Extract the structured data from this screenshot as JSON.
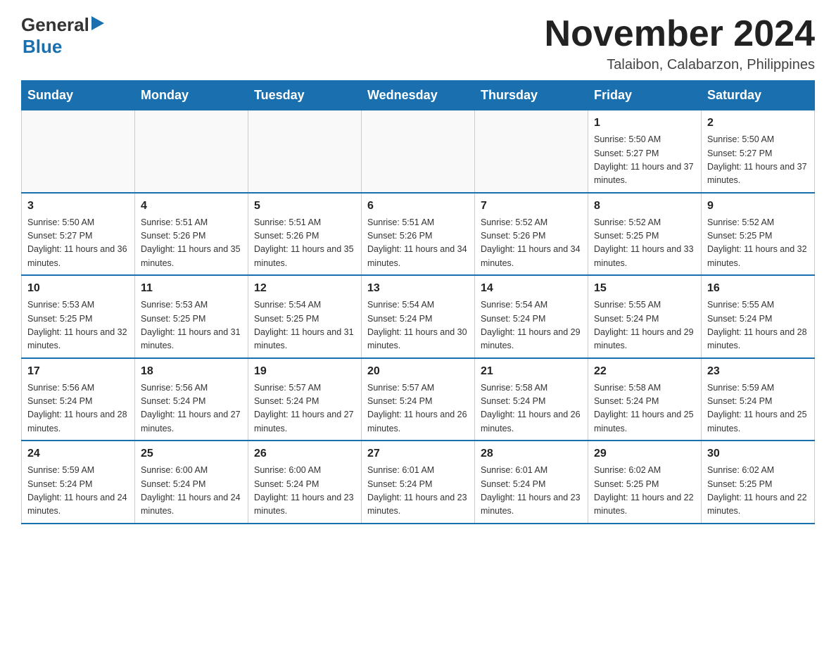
{
  "header": {
    "logo_general": "General",
    "logo_blue": "Blue",
    "main_title": "November 2024",
    "subtitle": "Talaibon, Calabarzon, Philippines"
  },
  "calendar": {
    "days_of_week": [
      "Sunday",
      "Monday",
      "Tuesday",
      "Wednesday",
      "Thursday",
      "Friday",
      "Saturday"
    ],
    "weeks": [
      [
        {
          "day": "",
          "info": ""
        },
        {
          "day": "",
          "info": ""
        },
        {
          "day": "",
          "info": ""
        },
        {
          "day": "",
          "info": ""
        },
        {
          "day": "",
          "info": ""
        },
        {
          "day": "1",
          "info": "Sunrise: 5:50 AM\nSunset: 5:27 PM\nDaylight: 11 hours and 37 minutes."
        },
        {
          "day": "2",
          "info": "Sunrise: 5:50 AM\nSunset: 5:27 PM\nDaylight: 11 hours and 37 minutes."
        }
      ],
      [
        {
          "day": "3",
          "info": "Sunrise: 5:50 AM\nSunset: 5:27 PM\nDaylight: 11 hours and 36 minutes."
        },
        {
          "day": "4",
          "info": "Sunrise: 5:51 AM\nSunset: 5:26 PM\nDaylight: 11 hours and 35 minutes."
        },
        {
          "day": "5",
          "info": "Sunrise: 5:51 AM\nSunset: 5:26 PM\nDaylight: 11 hours and 35 minutes."
        },
        {
          "day": "6",
          "info": "Sunrise: 5:51 AM\nSunset: 5:26 PM\nDaylight: 11 hours and 34 minutes."
        },
        {
          "day": "7",
          "info": "Sunrise: 5:52 AM\nSunset: 5:26 PM\nDaylight: 11 hours and 34 minutes."
        },
        {
          "day": "8",
          "info": "Sunrise: 5:52 AM\nSunset: 5:25 PM\nDaylight: 11 hours and 33 minutes."
        },
        {
          "day": "9",
          "info": "Sunrise: 5:52 AM\nSunset: 5:25 PM\nDaylight: 11 hours and 32 minutes."
        }
      ],
      [
        {
          "day": "10",
          "info": "Sunrise: 5:53 AM\nSunset: 5:25 PM\nDaylight: 11 hours and 32 minutes."
        },
        {
          "day": "11",
          "info": "Sunrise: 5:53 AM\nSunset: 5:25 PM\nDaylight: 11 hours and 31 minutes."
        },
        {
          "day": "12",
          "info": "Sunrise: 5:54 AM\nSunset: 5:25 PM\nDaylight: 11 hours and 31 minutes."
        },
        {
          "day": "13",
          "info": "Sunrise: 5:54 AM\nSunset: 5:24 PM\nDaylight: 11 hours and 30 minutes."
        },
        {
          "day": "14",
          "info": "Sunrise: 5:54 AM\nSunset: 5:24 PM\nDaylight: 11 hours and 29 minutes."
        },
        {
          "day": "15",
          "info": "Sunrise: 5:55 AM\nSunset: 5:24 PM\nDaylight: 11 hours and 29 minutes."
        },
        {
          "day": "16",
          "info": "Sunrise: 5:55 AM\nSunset: 5:24 PM\nDaylight: 11 hours and 28 minutes."
        }
      ],
      [
        {
          "day": "17",
          "info": "Sunrise: 5:56 AM\nSunset: 5:24 PM\nDaylight: 11 hours and 28 minutes."
        },
        {
          "day": "18",
          "info": "Sunrise: 5:56 AM\nSunset: 5:24 PM\nDaylight: 11 hours and 27 minutes."
        },
        {
          "day": "19",
          "info": "Sunrise: 5:57 AM\nSunset: 5:24 PM\nDaylight: 11 hours and 27 minutes."
        },
        {
          "day": "20",
          "info": "Sunrise: 5:57 AM\nSunset: 5:24 PM\nDaylight: 11 hours and 26 minutes."
        },
        {
          "day": "21",
          "info": "Sunrise: 5:58 AM\nSunset: 5:24 PM\nDaylight: 11 hours and 26 minutes."
        },
        {
          "day": "22",
          "info": "Sunrise: 5:58 AM\nSunset: 5:24 PM\nDaylight: 11 hours and 25 minutes."
        },
        {
          "day": "23",
          "info": "Sunrise: 5:59 AM\nSunset: 5:24 PM\nDaylight: 11 hours and 25 minutes."
        }
      ],
      [
        {
          "day": "24",
          "info": "Sunrise: 5:59 AM\nSunset: 5:24 PM\nDaylight: 11 hours and 24 minutes."
        },
        {
          "day": "25",
          "info": "Sunrise: 6:00 AM\nSunset: 5:24 PM\nDaylight: 11 hours and 24 minutes."
        },
        {
          "day": "26",
          "info": "Sunrise: 6:00 AM\nSunset: 5:24 PM\nDaylight: 11 hours and 23 minutes."
        },
        {
          "day": "27",
          "info": "Sunrise: 6:01 AM\nSunset: 5:24 PM\nDaylight: 11 hours and 23 minutes."
        },
        {
          "day": "28",
          "info": "Sunrise: 6:01 AM\nSunset: 5:24 PM\nDaylight: 11 hours and 23 minutes."
        },
        {
          "day": "29",
          "info": "Sunrise: 6:02 AM\nSunset: 5:25 PM\nDaylight: 11 hours and 22 minutes."
        },
        {
          "day": "30",
          "info": "Sunrise: 6:02 AM\nSunset: 5:25 PM\nDaylight: 11 hours and 22 minutes."
        }
      ]
    ]
  }
}
